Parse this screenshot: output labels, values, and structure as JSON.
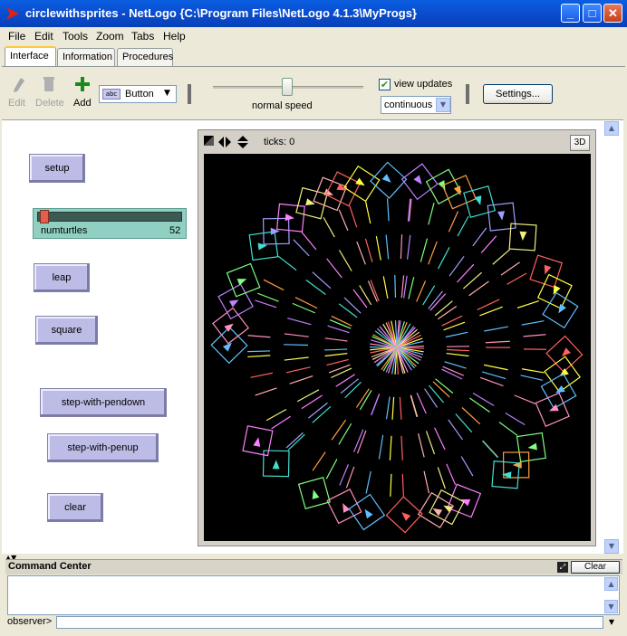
{
  "window": {
    "title": "circlewithsprites - NetLogo {C:\\Program Files\\NetLogo 4.1.3\\MyProgs}"
  },
  "menu": [
    "File",
    "Edit",
    "Tools",
    "Zoom",
    "Tabs",
    "Help"
  ],
  "tabs": [
    "Interface",
    "Information",
    "Procedures"
  ],
  "toolbar": {
    "edit": "Edit",
    "delete": "Delete",
    "add": "Add",
    "widget_type": "Button",
    "speed_label": "normal speed",
    "view_updates_label": "view updates",
    "view_updates_checked": true,
    "update_mode": "continuous",
    "settings": "Settings..."
  },
  "buttons": {
    "setup": "setup",
    "leap": "leap",
    "square": "square",
    "step_pendown": "step-with-pendown",
    "step_penup": "step-with-penup",
    "clear": "clear"
  },
  "slider": {
    "name": "numturtles",
    "value": "52",
    "fraction": 0.0
  },
  "view": {
    "ticks": "ticks: 0",
    "three_d": "3D"
  },
  "command_center": {
    "title": "Command Center",
    "clear": "Clear",
    "prompt": "observer>"
  },
  "colors": {
    "title_bar": "#0b52d8",
    "button": "#bcbce6",
    "slider": "#8fd0c2",
    "world": "#000000"
  }
}
